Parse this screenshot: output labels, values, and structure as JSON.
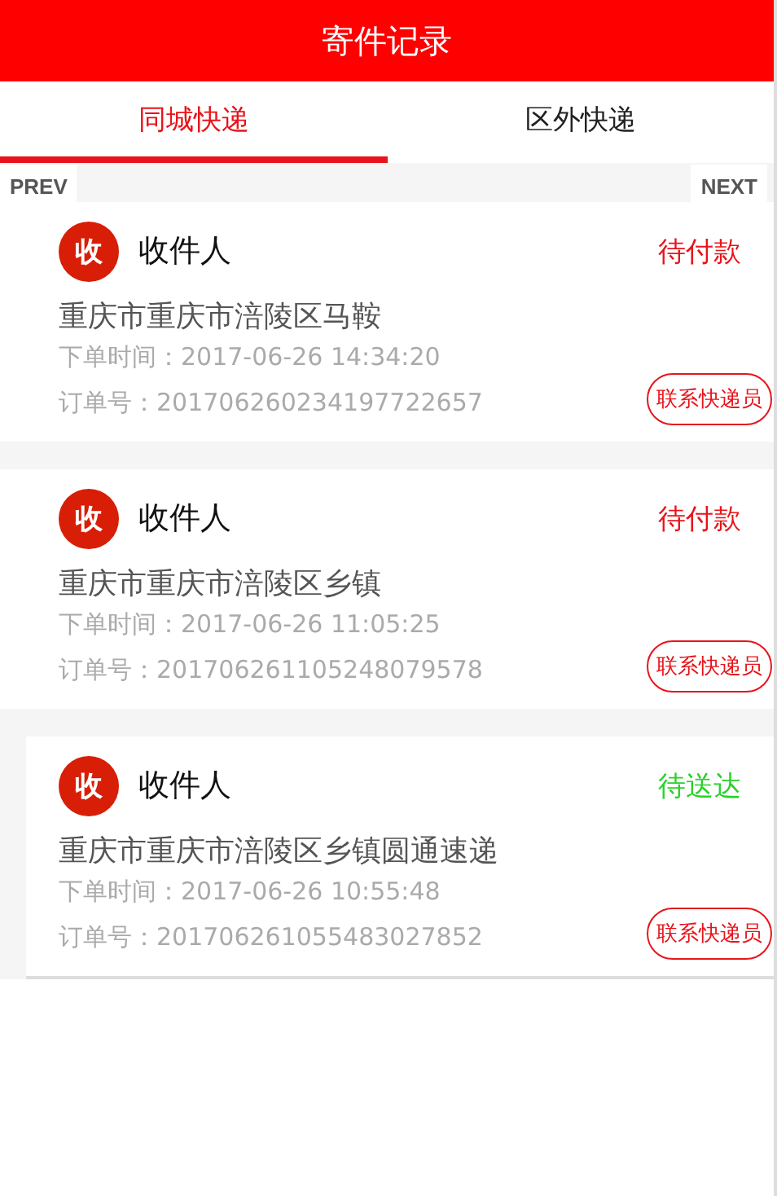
{
  "header": {
    "title": "寄件记录"
  },
  "tabs": [
    {
      "label": "同城快递",
      "selected": true
    },
    {
      "label": "区外快递",
      "selected": false
    }
  ],
  "pager": {
    "prev": "PREV",
    "next": "NEXT"
  },
  "orders": [
    {
      "badge": "收",
      "name": "收件人",
      "status": "待付款",
      "color": "#e8141b",
      "address": "重庆市重庆市涪陵区马鞍",
      "time_label": "下单时间：",
      "time": "2017-06-26 14:34:20",
      "order_label": "订单号：",
      "order_no": "201706260234197722657",
      "contact": "联系快递员"
    },
    {
      "badge": "收",
      "name": "收件人",
      "status": "待付款",
      "color": "#e8141b",
      "address": "重庆市重庆市涪陵区乡镇",
      "time_label": "下单时间：",
      "time": "2017-06-26 11:05:25",
      "order_label": "订单号：",
      "order_no": "201706261105248079578",
      "contact": "联系快递员"
    },
    {
      "badge": "收",
      "name": "收件人",
      "status": "待送达",
      "color": "#2ad12a",
      "address": "重庆市重庆市涪陵区乡镇圆通速递",
      "time_label": "下单时间：",
      "time": "2017-06-26 10:55:48",
      "order_label": "订单号：",
      "order_no": "201706261055483027852",
      "contact": "联系快递员"
    }
  ]
}
